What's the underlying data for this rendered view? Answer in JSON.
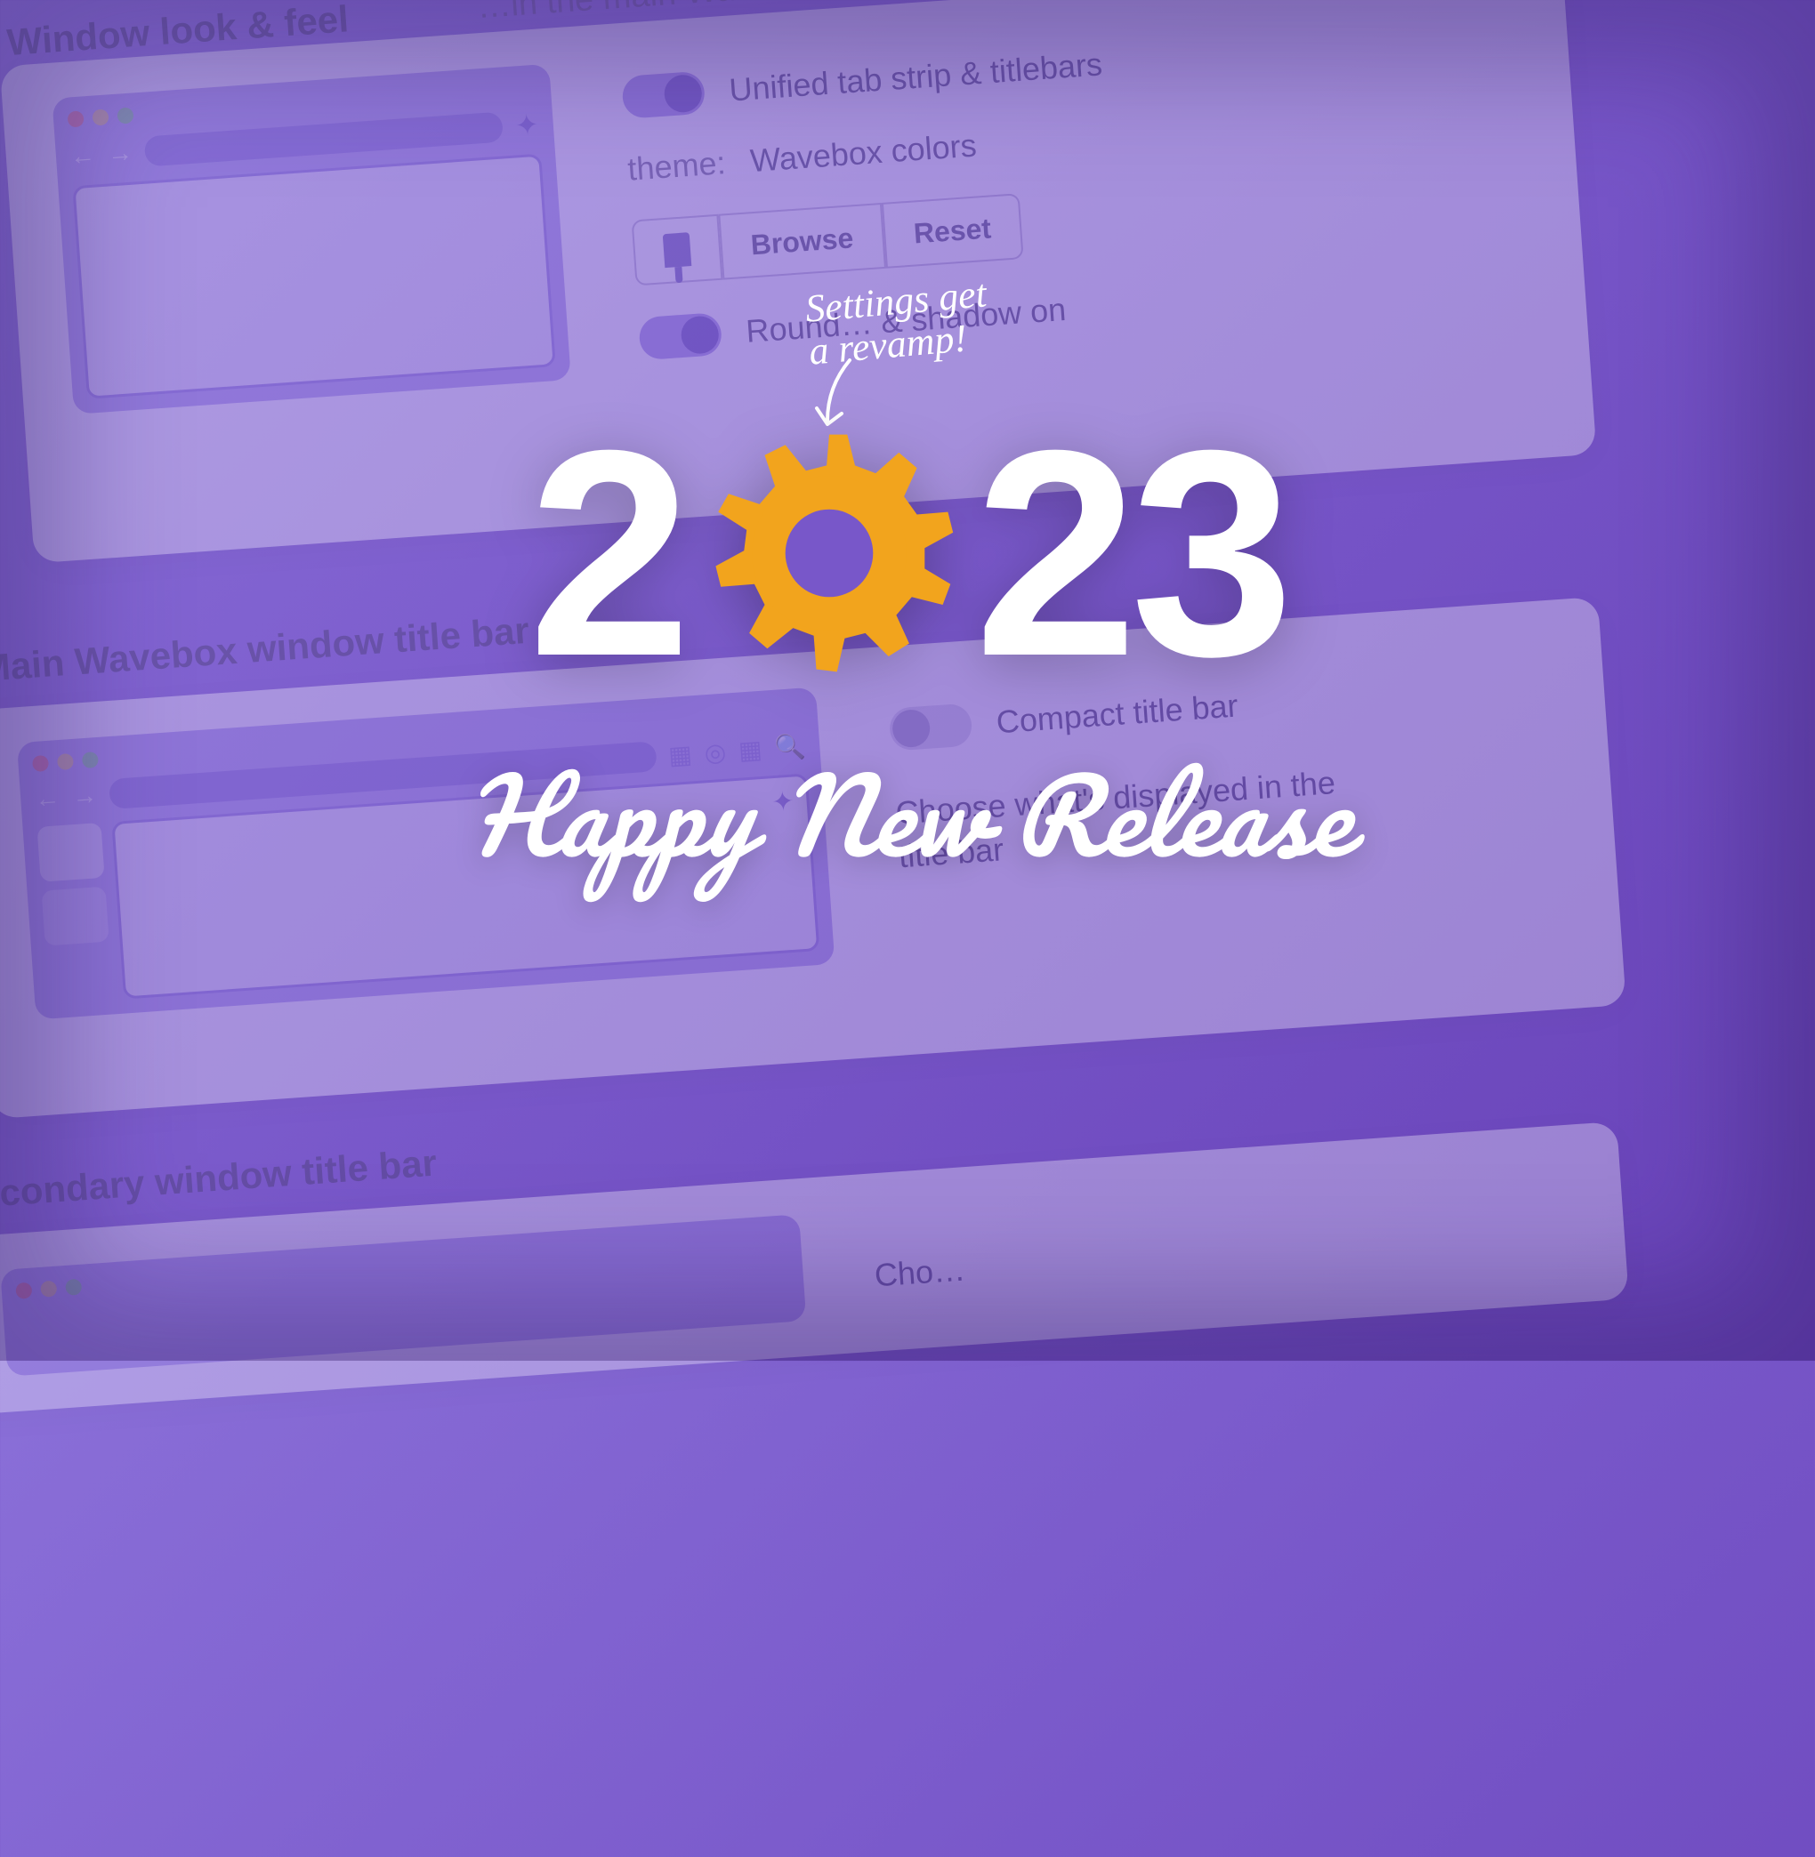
{
  "handwriting": {
    "line1": "Settings get",
    "line2": "a revamp!"
  },
  "year": {
    "d1": "2",
    "d2": "0",
    "d3": "2",
    "d4": "3"
  },
  "tagline": "Happy New Release",
  "bg": {
    "top_strip": "…in the main Wavebox window",
    "section1": {
      "title": "Window look & feel",
      "opt_unified": "Unified tab strip & titlebars",
      "theme_label": "theme:",
      "theme_value": "Wavebox colors",
      "browse": "Browse",
      "reset": "Reset",
      "rounded": "Round… & shadow on"
    },
    "section2": {
      "title": "Main Wavebox window title bar",
      "compact": "Compact title bar",
      "choose": "Choose what's displayed in the title bar"
    },
    "section3": {
      "title": "Secondary window title bar",
      "choose": "Cho…"
    }
  }
}
